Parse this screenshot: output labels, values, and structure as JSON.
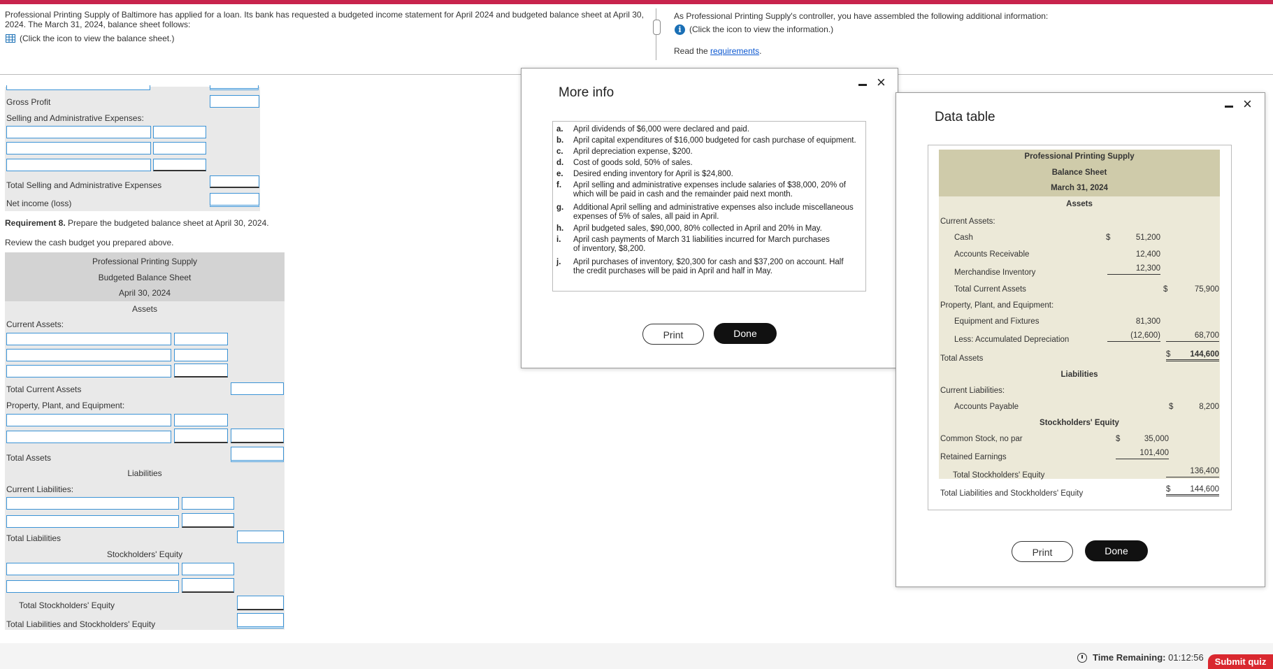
{
  "colors": {
    "accent_bar": "#c8244d",
    "input_border": "#3b93d6",
    "submit_bg": "#d9282f"
  },
  "intro": {
    "line1": "Professional Printing Supply of Baltimore has applied for a loan. Its bank has requested a budgeted income statement for April 2024 and budgeted balance sheet at April 30,",
    "line2": "2024. The March 31, 2024, balance sheet follows:",
    "balance_link": "(Click the icon to view the balance sheet.)"
  },
  "right_intro": {
    "line1": "As Professional Printing Supply's controller, you have assembled the following additional information:",
    "info_link": "(Click the icon to view the information.)",
    "read_prefix": "Read the ",
    "requirements_link": "requirements",
    "read_suffix": "."
  },
  "income": {
    "gross_profit": "Gross Profit",
    "sga": "Selling and Administrative Expenses:",
    "total_sga": "Total Selling and Administrative Expenses",
    "net_income": "Net income (loss)"
  },
  "req8": {
    "bold": "Requirement 8.",
    "text": " Prepare the budgeted balance sheet at April 30, 2024.",
    "review": "Review the cash budget you prepared above."
  },
  "budget_bs": {
    "company": "Professional Printing Supply",
    "title": "Budgeted Balance Sheet",
    "date": "April 30, 2024",
    "assets": "Assets",
    "current_assets": "Current Assets:",
    "total_current_assets": "Total Current Assets",
    "ppe": "Property, Plant, and Equipment:",
    "total_assets": "Total Assets",
    "liabilities": "Liabilities",
    "current_liabilities": "Current Liabilities:",
    "total_liabilities": "Total Liabilities",
    "equity": "Stockholders' Equity",
    "total_equity": "Total Stockholders' Equity",
    "total_liab_equity": "Total Liabilities and Stockholders' Equity"
  },
  "more_info": {
    "title": "More info",
    "items": [
      {
        "letter": "a.",
        "lines": [
          "April dividends of $6,000 were declared and paid."
        ]
      },
      {
        "letter": "b.",
        "lines": [
          "April capital expenditures of $16,000 budgeted for cash purchase of equipment."
        ]
      },
      {
        "letter": "c.",
        "lines": [
          "April depreciation expense, $200."
        ]
      },
      {
        "letter": "d.",
        "lines": [
          "Cost of goods sold, 50% of sales."
        ]
      },
      {
        "letter": "e.",
        "lines": [
          "Desired ending inventory for April is $24,800."
        ]
      },
      {
        "letter": "f.",
        "lines": [
          "April selling and administrative expenses include salaries of $38,000, 20% of",
          "which will be paid in cash and the remainder paid next month."
        ]
      },
      {
        "letter": "g.",
        "lines": [
          "Additional April selling and administrative expenses also include miscellaneous",
          "expenses of 5% of sales, all paid in April."
        ]
      },
      {
        "letter": "h.",
        "lines": [
          "April budgeted sales, $90,000, 80% collected in April and 20% in May."
        ]
      },
      {
        "letter": "i.",
        "lines": [
          "April cash payments of March 31 liabilities incurred for March purchases",
          "of inventory, $8,200."
        ]
      },
      {
        "letter": "j.",
        "lines": [
          "April purchases of inventory, $20,300 for cash and $37,200 on account. Half",
          "the credit purchases will be paid in April and half in May."
        ]
      }
    ],
    "print": "Print",
    "done": "Done"
  },
  "data_table": {
    "title": "Data table",
    "company": "Professional Printing Supply",
    "sheet": "Balance Sheet",
    "date": "March 31, 2024",
    "assets": "Assets",
    "current_assets": "Current Assets:",
    "cash": "Cash",
    "cash_sign": "$",
    "cash_val": "51,200",
    "ar": "Accounts Receivable",
    "ar_val": "12,400",
    "inv": "Merchandise Inventory",
    "inv_val": "12,300",
    "tca": "Total Current Assets",
    "tca_sign": "$",
    "tca_val": "75,900",
    "ppe": "Property, Plant, and Equipment:",
    "equip": "Equipment and Fixtures",
    "equip_val": "81,300",
    "accum": "Less: Accumulated Depreciation",
    "accum_val": "(12,600)",
    "net_ppe": "68,700",
    "ta": "Total Assets",
    "ta_sign": "$",
    "ta_val": "144,600",
    "liabilities": "Liabilities",
    "cl": "Current Liabilities:",
    "ap": "Accounts Payable",
    "ap_sign": "$",
    "ap_val": "8,200",
    "equity": "Stockholders' Equity",
    "cs": "Common Stock, no par",
    "cs_sign": "$",
    "cs_val": "35,000",
    "re": "Retained Earnings",
    "re_val": "101,400",
    "tse": "Total Stockholders' Equity",
    "tse_val": "136,400",
    "tle": "Total Liabilities and Stockholders' Equity",
    "tle_sign": "$",
    "tle_val": "144,600",
    "print": "Print",
    "done": "Done"
  },
  "footer": {
    "time_label": "Time Remaining:",
    "time_value": "01:12:56",
    "submit": "Submit quiz"
  }
}
